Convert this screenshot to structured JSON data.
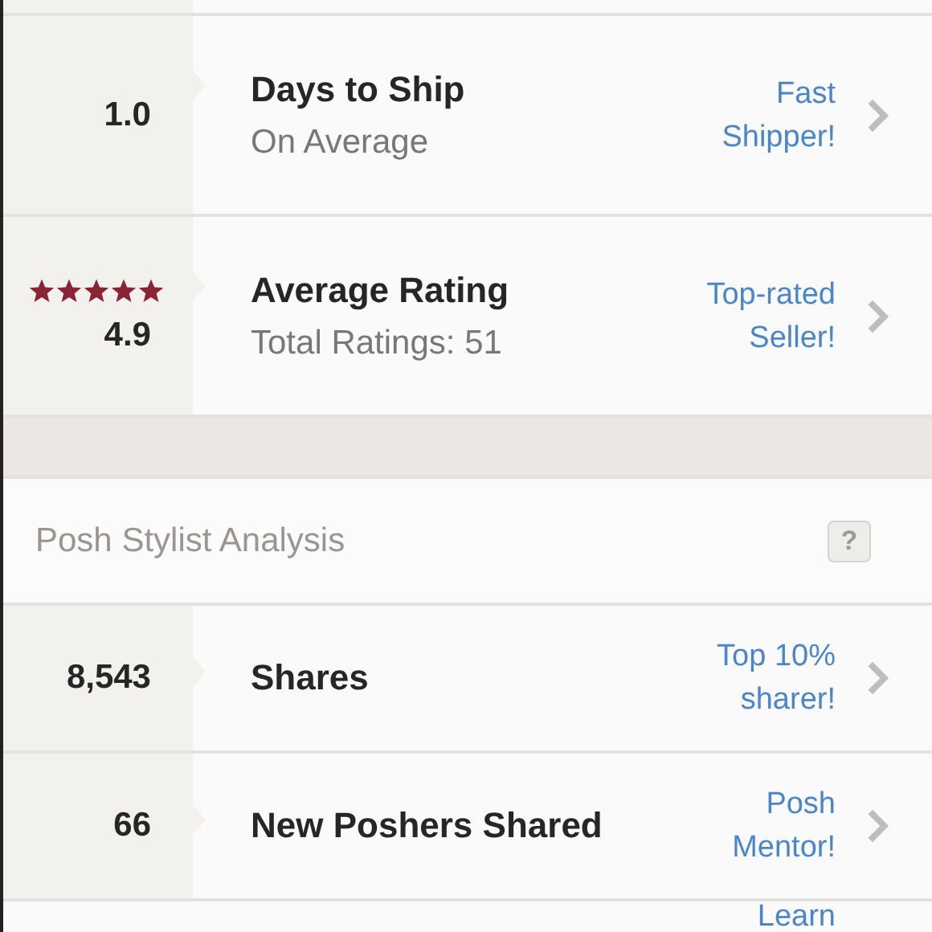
{
  "seller_stats": [
    {
      "value": "1.0",
      "title": "Days to Ship",
      "subtitle": "On Average",
      "badge": [
        "Fast",
        "Shipper!"
      ]
    },
    {
      "value": "4.9",
      "stars": 5,
      "title": "Average Rating",
      "subtitle": "Total Ratings: 51",
      "badge": [
        "Top-rated",
        "Seller!"
      ]
    }
  ],
  "section": {
    "title": "Posh Stylist Analysis",
    "help": "?"
  },
  "stylist_stats": [
    {
      "value": "8,543",
      "title": "Shares",
      "badge": [
        "Top 10%",
        "sharer!"
      ]
    },
    {
      "value": "66",
      "title": "New Poshers Shared",
      "badge": [
        "Posh",
        "Mentor!"
      ]
    },
    {
      "badge": [
        "Learn"
      ]
    }
  ]
}
